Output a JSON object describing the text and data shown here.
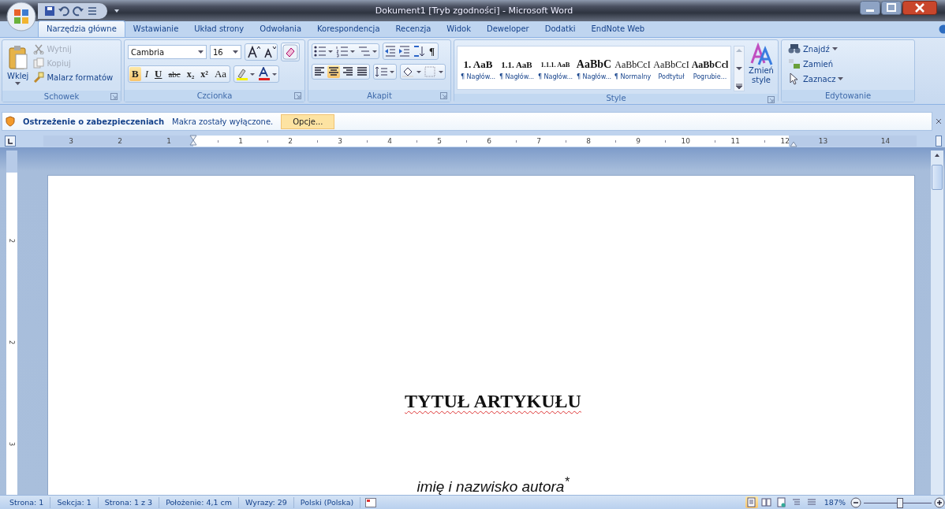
{
  "window": {
    "title": "Dokument1 [Tryb zgodności] - Microsoft Word"
  },
  "tabs": [
    {
      "label": "Narzędzia główne",
      "selected": true
    },
    {
      "label": "Wstawianie",
      "selected": false
    },
    {
      "label": "Układ strony",
      "selected": false
    },
    {
      "label": "Odwołania",
      "selected": false
    },
    {
      "label": "Korespondencja",
      "selected": false
    },
    {
      "label": "Recenzja",
      "selected": false
    },
    {
      "label": "Widok",
      "selected": false
    },
    {
      "label": "Deweloper",
      "selected": false
    },
    {
      "label": "Dodatki",
      "selected": false
    },
    {
      "label": "EndNote Web",
      "selected": false
    }
  ],
  "ribbon": {
    "clipboard": {
      "title": "Schowek",
      "paste": "Wklej",
      "items": [
        {
          "label": "Wytnij",
          "disabled": true
        },
        {
          "label": "Kopiuj",
          "disabled": true
        },
        {
          "label": "Malarz formatów",
          "disabled": false
        }
      ]
    },
    "font": {
      "title": "Czcionka",
      "font_name": "Cambria",
      "font_size": "16",
      "buttons": [
        {
          "label": "B",
          "selected": true
        },
        {
          "label": "I",
          "selected": false
        },
        {
          "label": "U",
          "selected": false
        },
        {
          "label": "abc",
          "selected": false
        },
        {
          "label": "x₂",
          "selected": false
        },
        {
          "label": "x²",
          "selected": false
        },
        {
          "label": "Aa",
          "selected": false
        }
      ]
    },
    "paragraph": {
      "title": "Akapit",
      "pilcrow": "¶",
      "alignments": [
        {
          "selected": false
        },
        {
          "selected": true
        },
        {
          "selected": false
        },
        {
          "selected": false
        }
      ]
    },
    "styles": {
      "title": "Style",
      "items": [
        {
          "preview": "1. AaB",
          "label": "¶ Nagłów...",
          "kind": "heading1"
        },
        {
          "preview": "1.1. AaB",
          "label": "¶ Nagłów...",
          "kind": "heading2"
        },
        {
          "preview": "1.1.1. AaB",
          "label": "¶ Nagłów...",
          "kind": "heading3"
        },
        {
          "preview": "AaBbC",
          "label": "¶ Nagłów...",
          "kind": "heading4"
        },
        {
          "preview": "AaBbCcI",
          "label": "¶ Normalny",
          "kind": "normal"
        },
        {
          "preview": "AaBbCcI",
          "label": "Podtytuł",
          "kind": "normal"
        },
        {
          "preview": "AaBbCcl",
          "label": "Pogrubie...",
          "kind": "strong"
        }
      ],
      "change_styles": "Zmień style"
    },
    "editing": {
      "title": "Edytowanie",
      "items": [
        {
          "label": "Znajdź",
          "kind": "find"
        },
        {
          "label": "Zamień",
          "kind": "replace"
        },
        {
          "label": "Zaznacz",
          "kind": "select"
        }
      ]
    }
  },
  "message_bar": {
    "title": "Ostrzeżenie o zabezpieczeniach",
    "text": "Makra zostały wyłączone.",
    "button": "Opcje..."
  },
  "ruler": {
    "left_labels": [
      "3",
      "2",
      "1"
    ],
    "right_labels": [
      "1",
      "2",
      "3",
      "4",
      "5",
      "6",
      "7",
      "8",
      "9",
      "10",
      "11",
      "12",
      "13",
      "14"
    ],
    "vertical_labels": [
      "2",
      "2",
      "3"
    ]
  },
  "document": {
    "title": "TYTUŁ ARTYKUŁU",
    "author": "imię i nazwisko autora$^{*}$"
  },
  "status_bar": {
    "items": [
      "Strona: 1",
      "Sekcja: 1",
      "Strona: 1 z 3",
      "Położenie: 4,1 cm",
      "Wyrazy: 29",
      "Polski (Polska)"
    ],
    "views": [
      {
        "selected": true
      },
      {
        "selected": false
      },
      {
        "selected": false
      },
      {
        "selected": false
      },
      {
        "selected": false
      }
    ],
    "zoom": "187%",
    "zoom_slider": {
      "level": 0.52
    }
  }
}
